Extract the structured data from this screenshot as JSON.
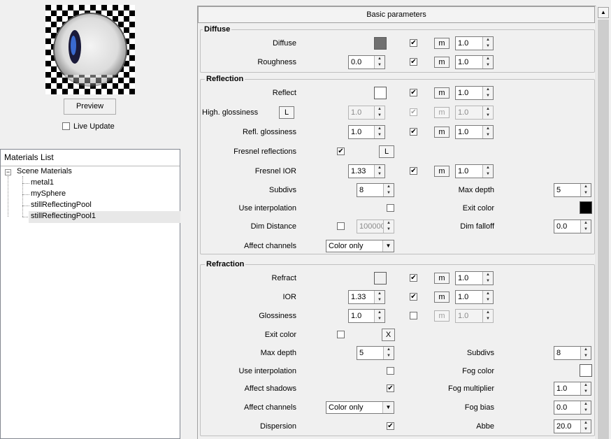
{
  "left": {
    "preview_button": "Preview",
    "live_update_label": "Live Update",
    "materials_list_title": "Materials List",
    "tree_root": "Scene Materials",
    "tree_items": [
      "metal1",
      "mySphere",
      "stillReflectingPool",
      "stillReflectingPool1"
    ],
    "selected_index": 3
  },
  "rollout": {
    "title": "Basic parameters",
    "diffuse": {
      "group_title": "Diffuse",
      "diffuse_label": "Diffuse",
      "diffuse_color": "#707070",
      "diffuse_m_value": "1.0",
      "roughness_label": "Roughness",
      "roughness_value": "0.0",
      "roughness_m_value": "1.0",
      "m_label": "m"
    },
    "reflection": {
      "group_title": "Reflection",
      "reflect_label": "Reflect",
      "reflect_color": "#ffffff",
      "reflect_m_value": "1.0",
      "high_gloss_label": "High. glossiness",
      "l_label": "L",
      "high_gloss_value": "1.0",
      "high_gloss_m_value": "1.0",
      "refl_gloss_label": "Refl. glossiness",
      "refl_gloss_value": "1.0",
      "refl_gloss_m_value": "1.0",
      "fresnel_label": "Fresnel reflections",
      "fresnel_ior_label": "Fresnel IOR",
      "fresnel_ior_value": "1.33",
      "fresnel_ior_m_value": "1.0",
      "subdivs_label": "Subdivs",
      "subdivs_value": "8",
      "max_depth_label": "Max depth",
      "max_depth_value": "5",
      "use_interp_label": "Use interpolation",
      "exit_color_label": "Exit color",
      "exit_color": "#000000",
      "dim_distance_label": "Dim Distance",
      "dim_distance_value": "100000",
      "dim_falloff_label": "Dim falloff",
      "dim_falloff_value": "0.0",
      "affect_channels_label": "Affect channels",
      "affect_channels_value": "Color only"
    },
    "refraction": {
      "group_title": "Refraction",
      "refract_label": "Refract",
      "refract_color": "#f0f0f0",
      "refract_m_value": "1.0",
      "ior_label": "IOR",
      "ior_value": "1.33",
      "ior_m_value": "1.0",
      "glossiness_label": "Glossiness",
      "glossiness_value": "1.0",
      "glossiness_m_value": "1.0",
      "exit_color_label": "Exit color",
      "x_label": "X",
      "max_depth_label": "Max depth",
      "max_depth_value": "5",
      "subdivs_label": "Subdivs",
      "subdivs_value": "8",
      "use_interp_label": "Use interpolation",
      "fog_color_label": "Fog color",
      "fog_color": "#ffffff",
      "affect_shadows_label": "Affect shadows",
      "fog_mult_label": "Fog multiplier",
      "fog_mult_value": "1.0",
      "affect_channels_label": "Affect channels",
      "affect_channels_value": "Color only",
      "fog_bias_label": "Fog bias",
      "fog_bias_value": "0.0",
      "dispersion_label": "Dispersion",
      "abbe_label": "Abbe",
      "abbe_value": "20.0"
    }
  }
}
